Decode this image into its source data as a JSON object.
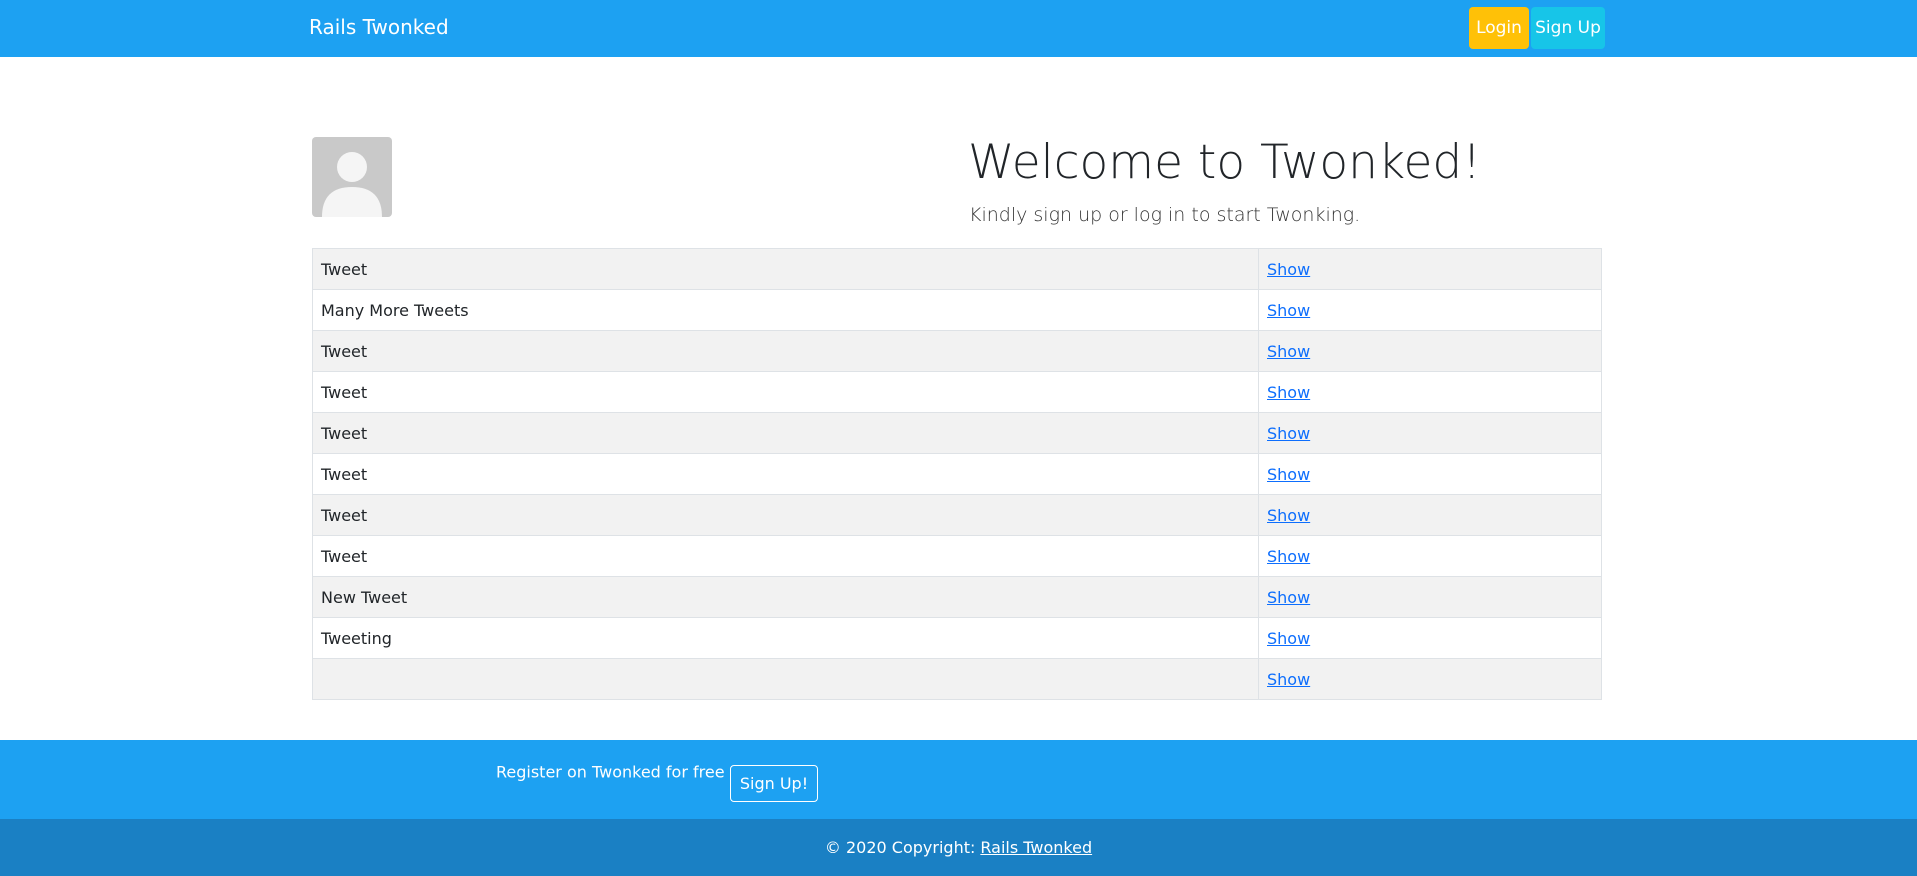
{
  "navbar": {
    "brand": "Rails Twonked",
    "login_label": "Login",
    "signup_label": "Sign Up",
    "background_color": "#1da1f2",
    "login_color": "#ffc107",
    "signup_color": "#17c5e8"
  },
  "hero": {
    "avatar_icon": "default-user-avatar-icon",
    "title": "Welcome to Twonked!",
    "subtitle": "Kindly sign up or log in to start Twonking."
  },
  "tweets": {
    "rows": [
      {
        "body": "Tweet",
        "link": "Show"
      },
      {
        "body": "Many More Tweets",
        "link": "Show"
      },
      {
        "body": "Tweet",
        "link": "Show"
      },
      {
        "body": "Tweet",
        "link": "Show"
      },
      {
        "body": "Tweet",
        "link": "Show"
      },
      {
        "body": "Tweet",
        "link": "Show"
      },
      {
        "body": "Tweet",
        "link": "Show"
      },
      {
        "body": "Tweet",
        "link": "Show"
      },
      {
        "body": "New Tweet",
        "link": "Show"
      },
      {
        "body": "Tweeting",
        "link": "Show"
      },
      {
        "body": "",
        "link": "Show"
      }
    ]
  },
  "footer": {
    "cta_text": "Register on Twonked for free",
    "cta_button": "Sign Up!",
    "copyright_prefix": "© 2020 Copyright:",
    "copyright_link": "Rails Twonked",
    "cta_background": "#1da1f2",
    "copyright_background": "#1a80c4"
  }
}
